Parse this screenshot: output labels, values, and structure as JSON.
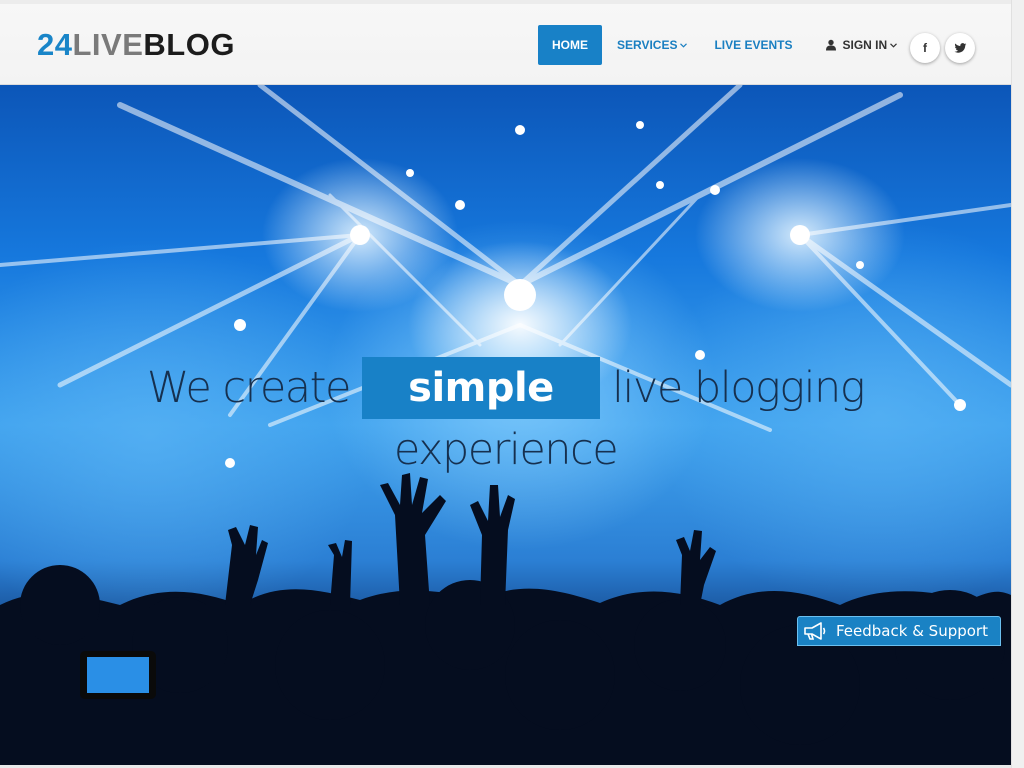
{
  "header": {
    "logo": {
      "num": "24",
      "live": "LIVE",
      "blog": "BLOG"
    },
    "nav": {
      "home": "HOME",
      "services": "SERVICES",
      "live_events": "LIVE EVENTS",
      "sign_in": "SIGN IN"
    },
    "social": {
      "facebook_glyph": "f",
      "twitter_icon": "twitter-icon"
    }
  },
  "hero": {
    "line1_left": "We create",
    "line1_highlight": "simple",
    "line1_right": "live blogging",
    "line2": "experience"
  },
  "feedback": {
    "label": "Feedback & Support"
  },
  "colors": {
    "accent": "#1881c7",
    "header_bg": "#f5f5f5",
    "headline_text": "#16304f"
  }
}
